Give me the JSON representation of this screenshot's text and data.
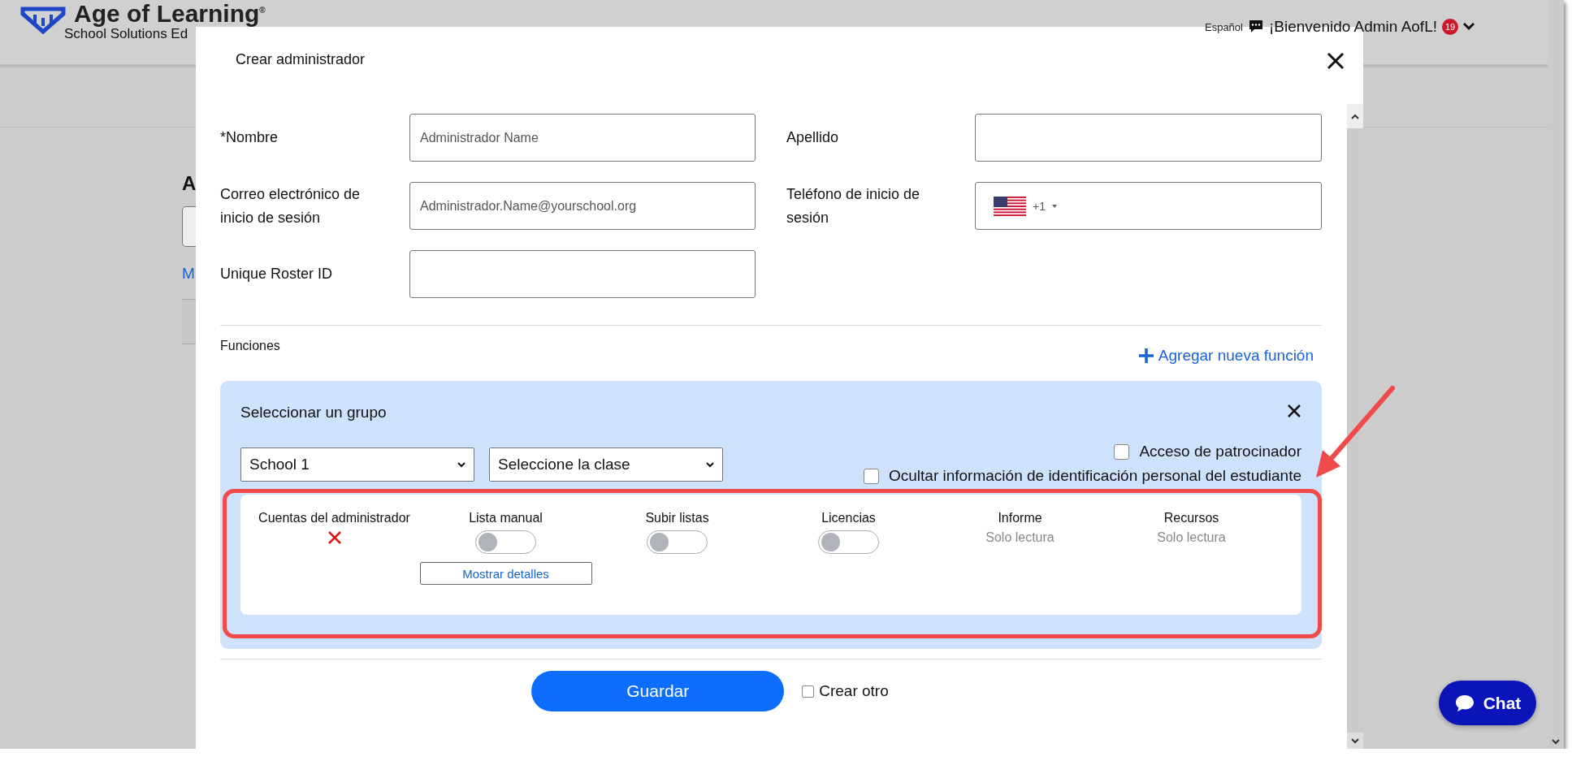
{
  "header": {
    "brand": "Age of Learning",
    "brand_mark": "®",
    "subtitle": "School Solutions Ed",
    "language": "Español",
    "welcome": "¡Bienvenido Admin AofL!",
    "badge": "19"
  },
  "background": {
    "heading": "A",
    "link": "M"
  },
  "modal": {
    "title": "Crear administrador",
    "fields": [
      {
        "label": "*Nombre",
        "placeholder": "Administrador Name",
        "kind": "text"
      },
      {
        "label": "Apellido",
        "kind": "text"
      },
      {
        "label": "Correo electrónico de inicio de sesión",
        "placeholder": "Administrador.Name@yourschool.org",
        "kind": "text"
      },
      {
        "label": "Teléfono de inicio de sesión",
        "code": "+1",
        "kind": "phone"
      },
      {
        "label": "Unique Roster ID",
        "kind": "text"
      }
    ],
    "functions_label": "Funciones",
    "add_function": "Agregar nueva función",
    "group": {
      "title": "Seleccionar un grupo",
      "school": "School 1",
      "class": "Seleccione la clase",
      "options": [
        {
          "label": "Acceso de patrocinador",
          "checked": false
        },
        {
          "label": "Ocultar información de identificación personal del estudiante",
          "checked": false
        }
      ],
      "permissions": [
        {
          "label": "Cuentas del administrador",
          "kind": "denied"
        },
        {
          "label": "Lista manual",
          "kind": "toggle",
          "on": false,
          "details": "Mostrar detalles"
        },
        {
          "label": "Subir listas",
          "kind": "toggle",
          "on": false
        },
        {
          "label": "Licencias",
          "kind": "toggle",
          "on": false
        },
        {
          "label": "Informe",
          "kind": "readonly",
          "note": "Solo lectura"
        },
        {
          "label": "Recursos",
          "kind": "readonly",
          "note": "Solo lectura"
        }
      ]
    },
    "save": "Guardar",
    "create_another": {
      "label": "Crear otro",
      "checked": false
    }
  },
  "chat": "Chat"
}
